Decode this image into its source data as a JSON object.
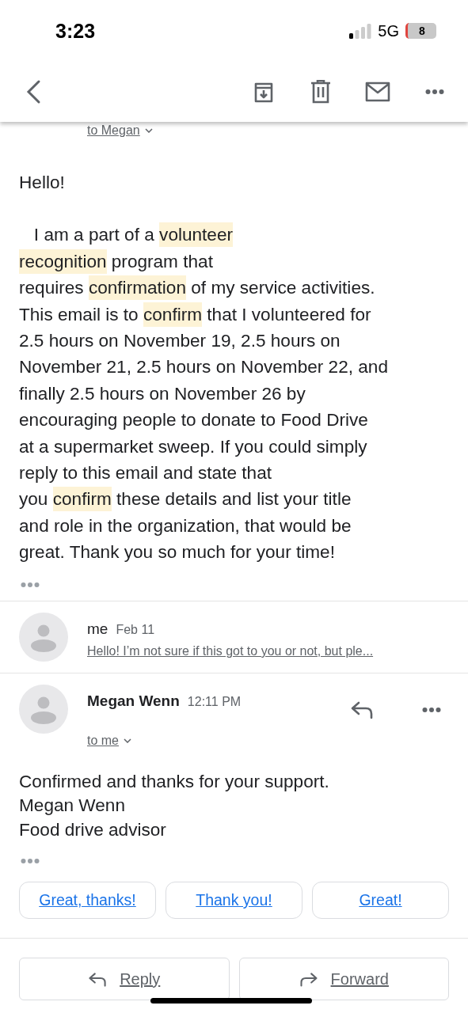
{
  "status_bar": {
    "time": "3:23",
    "network": "5G",
    "battery": "8"
  },
  "first_message": {
    "recipient": "to Megan",
    "body_lines": [
      [
        {
          "text": "Hello!",
          "highlight": false
        }
      ]
    ],
    "body_lines_2": [
      [
        {
          "text": "\tI am a part of a ",
          "highlight": false
        },
        {
          "text": "volunteer",
          "highlight": true
        }
      ],
      [
        {
          "text": "recognition",
          "highlight": true
        },
        {
          "text": " program that",
          "highlight": false
        }
      ],
      [
        {
          "text": "requires ",
          "highlight": false
        },
        {
          "text": "confirmation",
          "highlight": true
        },
        {
          "text": " of my service activities.",
          "highlight": false
        }
      ],
      [
        {
          "text": "This email is to ",
          "highlight": false
        },
        {
          "text": "confirm",
          "highlight": true
        },
        {
          "text": " that I volunteered for",
          "highlight": false
        }
      ],
      [
        {
          "text": "2.5 hours on November 19, 2.5 hours on",
          "highlight": false
        }
      ],
      [
        {
          "text": "November 21, 2.5 hours on November 22, and",
          "highlight": false
        }
      ],
      [
        {
          "text": "finally 2.5 hours on November 26 by",
          "highlight": false
        }
      ],
      [
        {
          "text": "encouraging people to donate to Food Drive",
          "highlight": false
        }
      ],
      [
        {
          "text": "at a supermarket sweep. If you could simply",
          "highlight": false
        }
      ],
      [
        {
          "text": "reply to this email and state that",
          "highlight": false
        }
      ],
      [
        {
          "text": "you ",
          "highlight": false
        },
        {
          "text": "confirm",
          "highlight": true
        },
        {
          "text": " these details and list your title",
          "highlight": false
        }
      ],
      [
        {
          "text": "and role in the organization, that would be",
          "highlight": false
        }
      ],
      [
        {
          "text": "great. Thank you so much for your time!",
          "highlight": false
        }
      ]
    ]
  },
  "collapsed_message": {
    "sender": "me",
    "date": "Feb 11",
    "snippet": "Hello! I’m not sure if this got to you or not, but ple..."
  },
  "latest_message": {
    "sender": "Megan Wenn",
    "time": "12:11 PM",
    "recipient": "to me",
    "body_lines": [
      "Confirmed and thanks for your support.",
      "Megan Wenn",
      "Food drive advisor"
    ]
  },
  "smart_replies": [
    "Great, thanks!",
    "Thank you!",
    "Great!"
  ],
  "actions": [
    {
      "label": "Reply",
      "kind": "reply"
    },
    {
      "label": "Forward",
      "kind": "forward"
    }
  ]
}
